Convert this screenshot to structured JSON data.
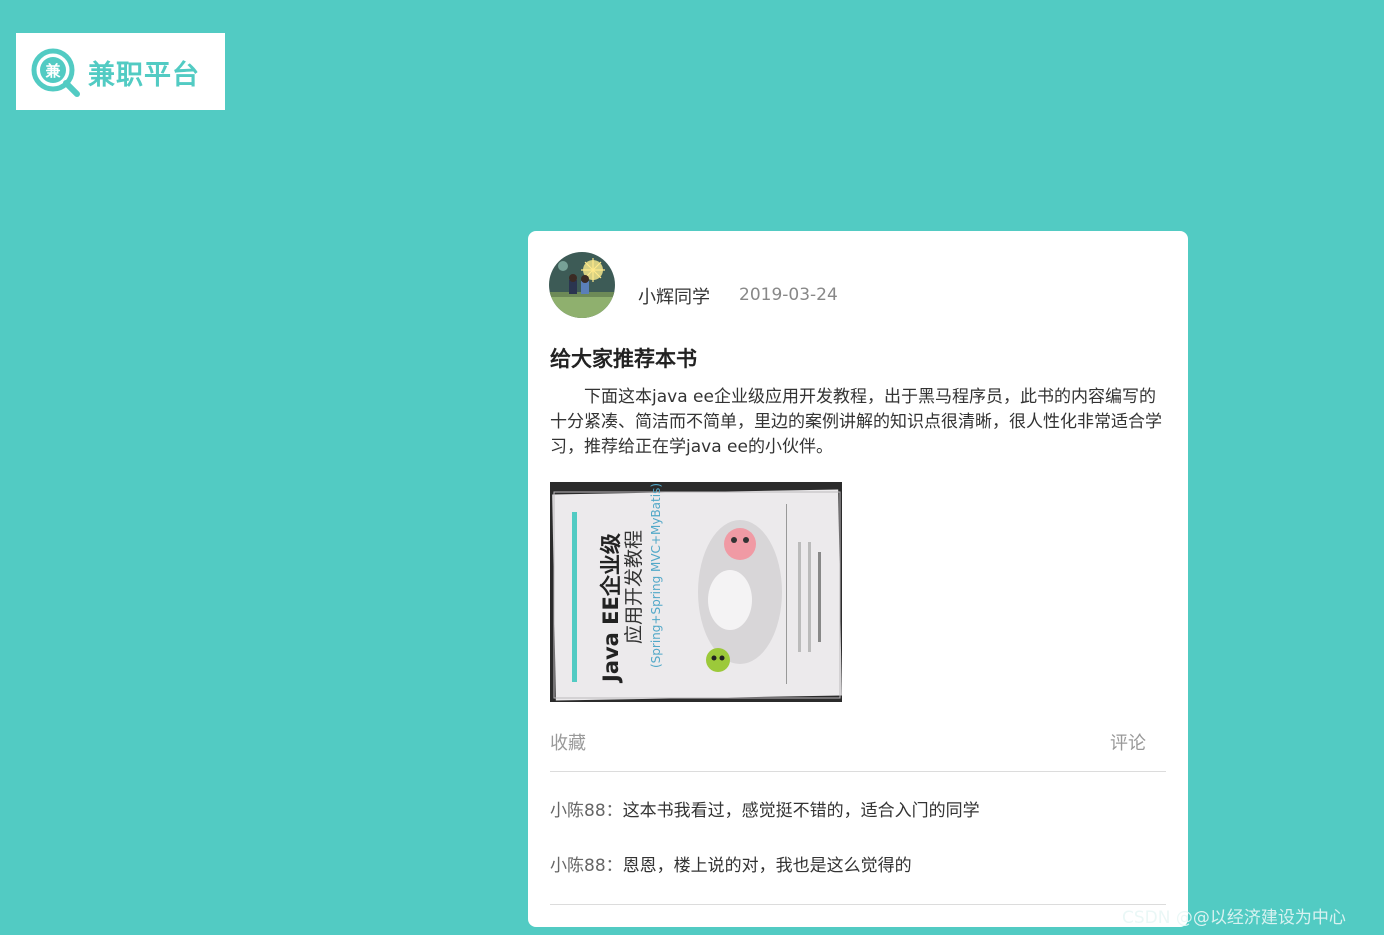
{
  "brand": {
    "logo_glyph": "兼",
    "name": "兼职平台",
    "color": "#52cbc3"
  },
  "post": {
    "author": "小辉同学",
    "date": "2019-03-24",
    "title": "给大家推荐本书",
    "body": "下面这本java ee企业级应用开发教程，出于黑马程序员，此书的内容编写的十分紧凑、简洁而不简单，里边的案例讲解的知识点很清晰，很人性化非常适合学习，推荐给正在学java ee的小伙伴。",
    "image": {
      "title_line1": "Java EE企业级",
      "title_line2": "应用开发教程",
      "subtitle": "(Spring+Spring MVC+MyBatis)"
    },
    "actions": {
      "collect": "收藏",
      "comment": "评论"
    }
  },
  "comments": [
    {
      "user": "小陈88：",
      "text": "这本书我看过，感觉挺不错的，适合入门的同学"
    },
    {
      "user": "小陈88：",
      "text": "恩恩，楼上说的对，我也是这么觉得的"
    }
  ],
  "watermark": "CSDN @@以经济建设为中心",
  "colors": {
    "background": "#52cbc3",
    "card": "#ffffff",
    "muted": "#999999"
  }
}
